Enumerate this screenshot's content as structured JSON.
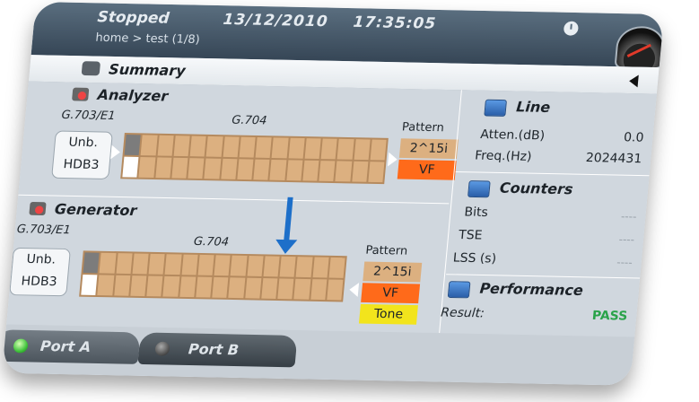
{
  "header": {
    "status": "Stopped",
    "date": "13/12/2010",
    "time": "17:35:05",
    "breadcrumb": "home > test (1/8)"
  },
  "summary": {
    "title": "Summary"
  },
  "analyzer": {
    "title": "Analyzer",
    "interface": "G.703/E1",
    "framing": "G.704",
    "pattern_label": "Pattern",
    "mode_line1": "Unb.",
    "mode_line2": "HDB3",
    "patterns": [
      "2^15i",
      "VF"
    ]
  },
  "generator": {
    "title": "Generator",
    "interface": "G.703/E1",
    "framing": "G.704",
    "pattern_label": "Pattern",
    "mode_line1": "Unb.",
    "mode_line2": "HDB3",
    "patterns": [
      "2^15i",
      "VF",
      "Tone"
    ]
  },
  "line": {
    "title": "Line",
    "rows": [
      {
        "label": "Atten.(dB)",
        "value": "0.0"
      },
      {
        "label": "Freq.(Hz)",
        "value": "2024431"
      }
    ]
  },
  "counters": {
    "title": "Counters",
    "rows": [
      {
        "label": "Bits",
        "value": "----"
      },
      {
        "label": "TSE",
        "value": "----"
      },
      {
        "label": "LSS (s)",
        "value": "----"
      }
    ]
  },
  "performance": {
    "title": "Performance",
    "result_label": "Result:",
    "result_value": "PASS"
  },
  "ports": [
    {
      "label": "Port A"
    },
    {
      "label": "Port B"
    }
  ],
  "colors": {
    "pattern_tan": "#dcb080",
    "pattern_orange": "#ff6a1a",
    "pattern_yellow": "#f2e41c",
    "pass_green": "#2aa34a",
    "flow_arrow": "#1d6fc9"
  },
  "icons": {
    "clock": "clock-icon",
    "gauge": "gauge-icon",
    "summary": "summary-icon",
    "analyzer": "analyzer-icon",
    "generator": "generator-icon",
    "line": "line-icon",
    "counters": "counters-icon",
    "performance": "performance-icon"
  }
}
